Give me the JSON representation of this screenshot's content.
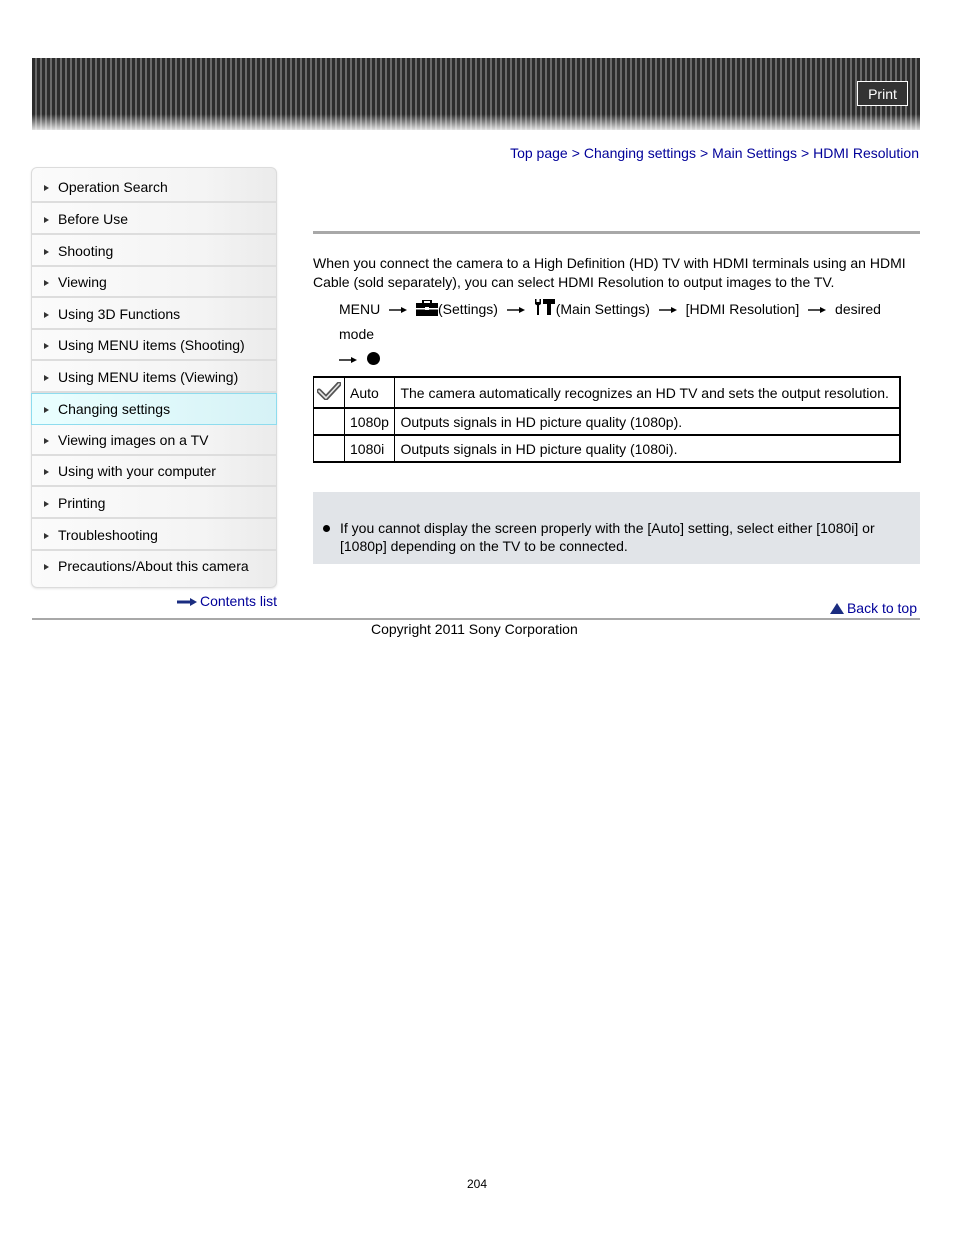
{
  "header": {
    "print_label": "Print"
  },
  "breadcrumb": {
    "items": [
      "Top page",
      "Changing settings",
      "Main Settings",
      "HDMI Resolution"
    ],
    "separator": ">"
  },
  "sidebar": {
    "items": [
      {
        "label": "Operation Search",
        "active": false
      },
      {
        "label": "Before Use",
        "active": false
      },
      {
        "label": "Shooting",
        "active": false
      },
      {
        "label": "Viewing",
        "active": false
      },
      {
        "label": "Using 3D Functions",
        "active": false
      },
      {
        "label": "Using MENU items (Shooting)",
        "active": false
      },
      {
        "label": "Using MENU items (Viewing)",
        "active": false
      },
      {
        "label": "Changing settings",
        "active": true
      },
      {
        "label": "Viewing images on a TV",
        "active": false
      },
      {
        "label": "Using with your computer",
        "active": false
      },
      {
        "label": "Printing",
        "active": false
      },
      {
        "label": "Troubleshooting",
        "active": false
      },
      {
        "label": "Precautions/About this camera",
        "active": false
      }
    ],
    "contents_list_label": "Contents list"
  },
  "main": {
    "intro": "When you connect the camera to a High Definition (HD) TV with HDMI terminals using an HDMI Cable (sold separately), you can select HDMI Resolution to output images to the TV.",
    "path": {
      "menu": "MENU",
      "settings": "(Settings)",
      "main_settings": "(Main Settings)",
      "hdmi_resolution": "[HDMI Resolution]",
      "desired_mode": "desired mode",
      "icons": [
        "toolbox-icon",
        "wrench-hammer-icon",
        "arrow-right-icon",
        "bullet-dot-icon"
      ]
    },
    "modes_table": [
      {
        "default": true,
        "mode": "Auto",
        "description": "The camera automatically recognizes an HD TV and sets the output resolution."
      },
      {
        "default": false,
        "mode": "1080p",
        "description": "Outputs signals in HD picture quality (1080p)."
      },
      {
        "default": false,
        "mode": "1080i",
        "description": "Outputs signals in HD picture quality (1080i)."
      }
    ],
    "notes": [
      "If you cannot display the screen properly with the [Auto] setting, select either [1080i] or [1080p] depending on the TV to be connected."
    ],
    "back_to_top_label": "Back to top"
  },
  "footer": {
    "copyright": "Copyright 2011 Sony Corporation",
    "page_number": "204"
  }
}
